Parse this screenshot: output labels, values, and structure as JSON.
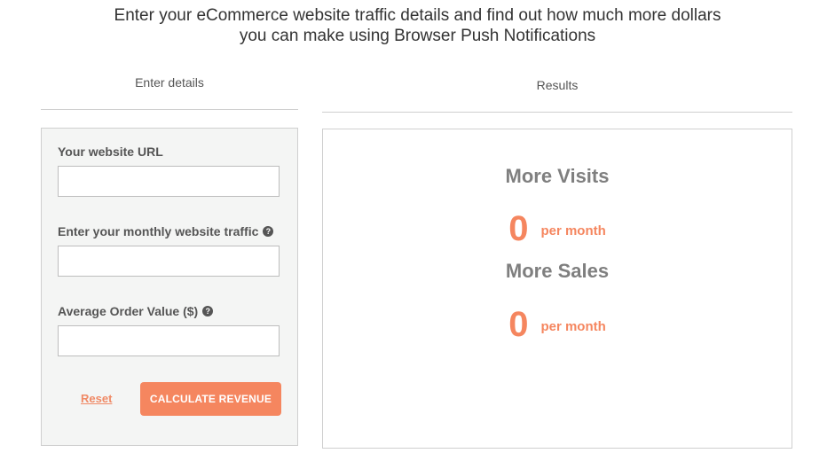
{
  "headline": {
    "line1": "Enter your eCommerce website traffic details and find out how much more dollars",
    "line2": "you can make using Browser Push Notifications"
  },
  "left_column": {
    "title": "Enter details",
    "fields": {
      "url": {
        "label": "Your website URL",
        "value": "",
        "placeholder": ""
      },
      "traffic": {
        "label": "Enter your monthly website traffic",
        "value": "",
        "placeholder": "",
        "help_icon": "question-circle-icon"
      },
      "aov": {
        "label": "Average Order Value ($)",
        "value": "",
        "placeholder": "",
        "help_icon": "question-circle-icon"
      }
    },
    "reset_label": "Reset",
    "calculate_label": "CALCULATE REVENUE"
  },
  "right_column": {
    "title": "Results",
    "visits": {
      "title": "More Visits",
      "value": "0",
      "unit": "per month"
    },
    "sales": {
      "title": "More Sales",
      "value": "0",
      "unit": "per month"
    }
  },
  "colors": {
    "accent": "#f5865f",
    "muted_text": "#7f7f7f",
    "panel_bg": "#f4f5f4",
    "border": "#cfcfcf"
  }
}
